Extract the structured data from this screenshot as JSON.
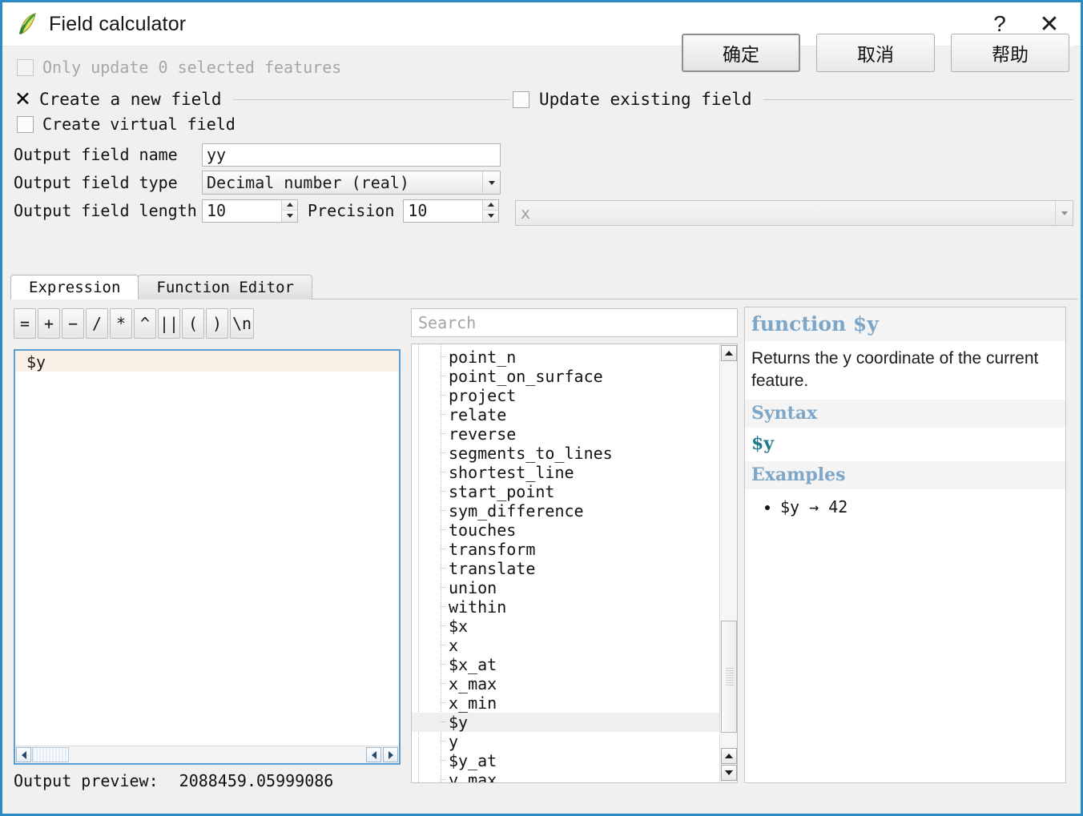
{
  "window": {
    "title": "Field calculator",
    "icon": "qgis-leaf-icon",
    "help_button": "?",
    "close_button": "✕",
    "border_color": "#2a8bc4"
  },
  "options": {
    "only_update_selected": {
      "label": "Only update 0 selected features",
      "checked": false,
      "disabled": true
    },
    "create_new_field": {
      "label": "Create a new field",
      "checked": true
    },
    "update_existing_field": {
      "label": "Update existing field",
      "checked": false
    },
    "create_virtual_field": {
      "label": "Create virtual field",
      "checked": false
    }
  },
  "form": {
    "field_name_label": "Output field name",
    "field_name_value": "yy",
    "field_type_label": "Output field type",
    "field_type_value": "Decimal number (real)",
    "field_length_label": "Output field length",
    "field_length_value": "10",
    "precision_label": "Precision",
    "precision_value": "10",
    "existing_field_value": "x"
  },
  "tabs": [
    {
      "label": "Expression",
      "active": true
    },
    {
      "label": "Function Editor",
      "active": false
    }
  ],
  "operators": [
    "=",
    "+",
    "−",
    "/",
    "*",
    "^",
    "||",
    "(",
    ")",
    "\\n"
  ],
  "expression": {
    "text": "$y",
    "current_line_color": "#fbf0e6"
  },
  "output_preview": {
    "label": "Output preview:",
    "value": "2088459.05999086"
  },
  "search": {
    "placeholder": "Search",
    "value": ""
  },
  "function_list": {
    "items": [
      {
        "name": "point_n",
        "selected": false
      },
      {
        "name": "point_on_surface",
        "selected": false
      },
      {
        "name": "project",
        "selected": false
      },
      {
        "name": "relate",
        "selected": false
      },
      {
        "name": "reverse",
        "selected": false
      },
      {
        "name": "segments_to_lines",
        "selected": false
      },
      {
        "name": "shortest_line",
        "selected": false
      },
      {
        "name": "start_point",
        "selected": false
      },
      {
        "name": "sym_difference",
        "selected": false
      },
      {
        "name": "touches",
        "selected": false
      },
      {
        "name": "transform",
        "selected": false
      },
      {
        "name": "translate",
        "selected": false
      },
      {
        "name": "union",
        "selected": false
      },
      {
        "name": "within",
        "selected": false
      },
      {
        "name": "$x",
        "selected": false
      },
      {
        "name": "x",
        "selected": false
      },
      {
        "name": "$x_at",
        "selected": false
      },
      {
        "name": "x_max",
        "selected": false
      },
      {
        "name": "x_min",
        "selected": false
      },
      {
        "name": "$y",
        "selected": true
      },
      {
        "name": "y",
        "selected": false
      },
      {
        "name": "$y_at",
        "selected": false
      },
      {
        "name": "y_max",
        "selected": false
      }
    ]
  },
  "help": {
    "title": "function $y",
    "description": "Returns the y coordinate of the current feature.",
    "syntax_heading": "Syntax",
    "syntax": "$y",
    "examples_heading": "Examples",
    "examples": [
      "$y → 42"
    ]
  },
  "footer": {
    "ok": "确定",
    "cancel": "取消",
    "help": "帮助"
  }
}
